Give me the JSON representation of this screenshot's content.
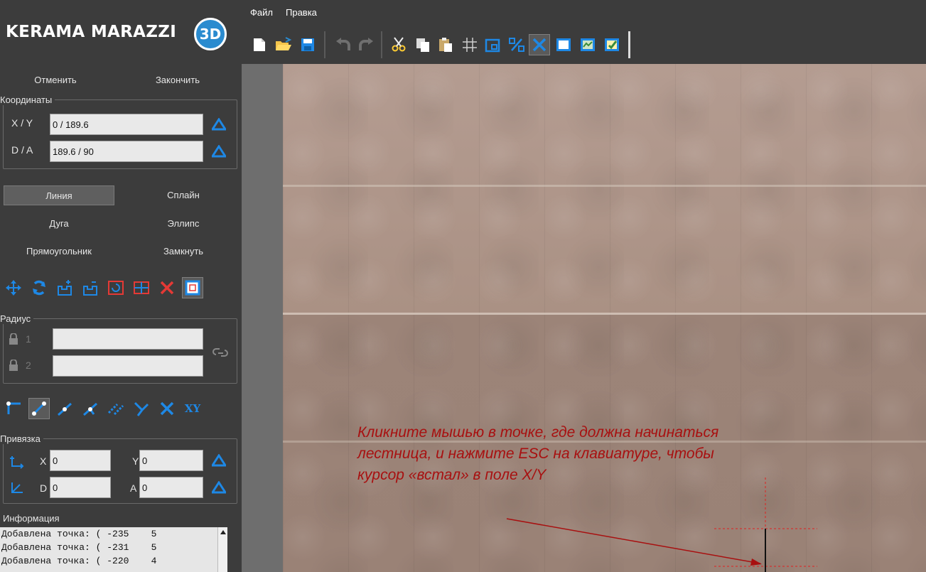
{
  "app": {
    "brand": "KERAMA MARAZZI",
    "badge": "3D"
  },
  "menu": [
    "Файл",
    "Правка"
  ],
  "sidebar": {
    "cancel_label": "Отменить",
    "finish_label": "Закончить",
    "coords": {
      "title": "Координаты",
      "xy_label": "X / Y",
      "xy_value": "0 / 189.6",
      "da_label": "D / A",
      "da_value": "189.6 / 90"
    },
    "modes": [
      "Линия",
      "Сплайн",
      "Дуга",
      "Эллипс",
      "Прямоугольник",
      "Замкнуть"
    ],
    "active_mode": "Линия",
    "radius": {
      "title": "Радиус",
      "row1": "1",
      "row2": "2",
      "value1": "",
      "value2": ""
    },
    "snap_icons_text": "XY",
    "snap": {
      "title": "Привязка",
      "x_label": "X",
      "x_value": "0",
      "y_label": "Y",
      "y_value": "0",
      "d_label": "D",
      "d_value": "0",
      "a_label": "A",
      "a_value": "0"
    },
    "info": {
      "title": "Информация",
      "lines": [
        "Добавлена точка: ( -235    5",
        "Добавлена точка: ( -231    5",
        "Добавлена точка: ( -220    4"
      ]
    }
  },
  "canvas": {
    "note": "Кликните мышью в точке, где должна начинаться лестница, и нажмите ESC на клавиатуре, чтобы курсор «встал» в поле X/Y",
    "note_color": "#a81010"
  },
  "colors": {
    "panel": "#3c3c3c",
    "accent_blue": "#1e88e5",
    "field_bg": "#e9e9e9"
  }
}
